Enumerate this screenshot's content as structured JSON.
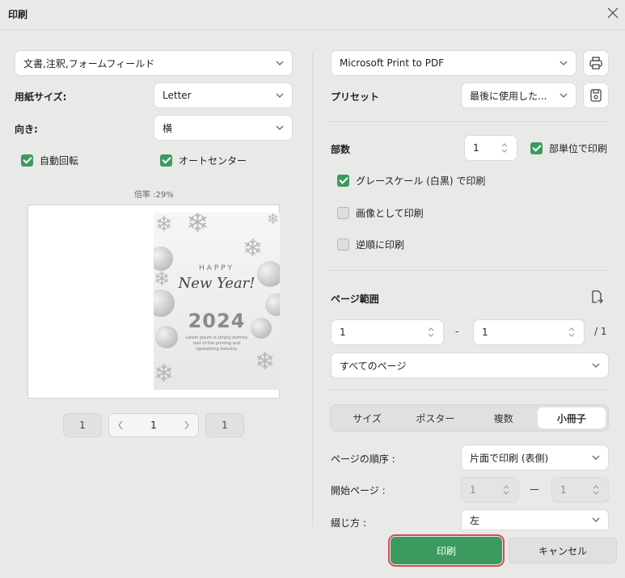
{
  "window": {
    "title": "印刷"
  },
  "left": {
    "content_select": "文書,注釈,フォームフィールド",
    "paper_size_label": "用紙サイズ:",
    "paper_size_value": "Letter",
    "orientation_label": "向き:",
    "orientation_value": "横",
    "auto_rotate_label": "自動回転",
    "auto_center_label": "オートセンター",
    "zoom_label": "倍率 :29%",
    "preview_card": {
      "happy": "HAPPY",
      "new_year": "New Year!",
      "year": "2024",
      "body": "Lorem ipsum is simply dummy text of the printing and typesetting industry."
    },
    "pager": {
      "first": "1",
      "current": "1",
      "last": "1"
    }
  },
  "right": {
    "printer": "Microsoft Print to PDF",
    "preset_label": "プリセット",
    "preset_value": "最後に使用した...",
    "copies_label": "部数",
    "copies_value": "1",
    "collate_label": "部単位で印刷",
    "grayscale_label": "グレースケール (白黒) で印刷",
    "as_image_label": "画像として印刷",
    "reverse_label": "逆順に印刷",
    "page_range_label": "ページ範囲",
    "range_from": "1",
    "range_to": "1",
    "range_total": "/ 1",
    "range_dash": "-",
    "all_pages": "すべてのページ",
    "tabs": [
      "サイズ",
      "ポスター",
      "複数",
      "小冊子"
    ],
    "page_order_label": "ページの順序 :",
    "page_order_value": "片面で印刷 (表側)",
    "start_page_label": "開始ページ :",
    "start_from": "1",
    "start_to": "1",
    "start_dash": "—",
    "binding_label": "綴じ方 :",
    "binding_value": "左"
  },
  "footer": {
    "print": "印刷",
    "cancel": "キャンセル"
  },
  "colors": {
    "accent": "#3c9a5f",
    "highlight": "#e04848"
  }
}
